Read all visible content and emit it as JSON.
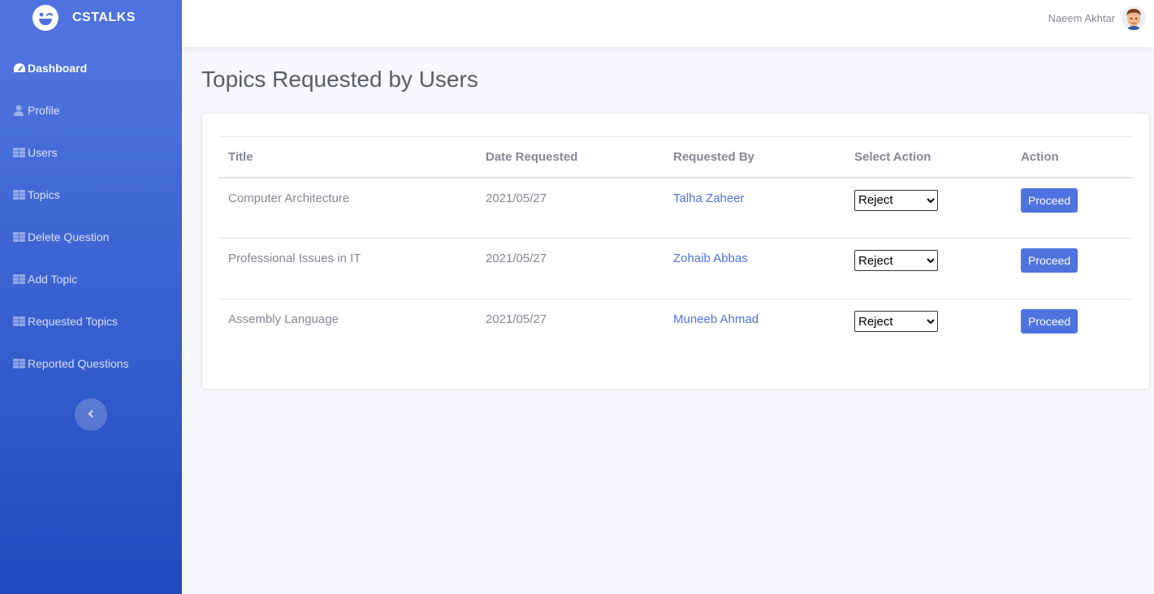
{
  "app": {
    "brand": "CSTALKS"
  },
  "sidebar": {
    "items": [
      {
        "label": "Dashboard",
        "icon": "tachometer-icon",
        "active": true
      },
      {
        "label": "Profile",
        "icon": "user-icon"
      },
      {
        "label": "Users",
        "icon": "table-icon"
      },
      {
        "label": "Topics",
        "icon": "table-icon"
      },
      {
        "label": "Delete Question",
        "icon": "table-icon"
      },
      {
        "label": "Add Topic",
        "icon": "table-icon"
      },
      {
        "label": "Requested Topics",
        "icon": "table-icon"
      },
      {
        "label": "Reported Questions",
        "icon": "table-icon"
      }
    ],
    "toggle_icon": "chevron-left-icon"
  },
  "topbar": {
    "user_name": "Naeem Akhtar"
  },
  "main": {
    "title": "Topics Requested by Users",
    "table": {
      "headers": [
        "Title",
        "Date Requested",
        "Requested By",
        "Select Action",
        "Action"
      ],
      "rows": [
        {
          "title": "Computer Architecture",
          "date": "2021/05/27",
          "requested_by": "Talha Zaheer",
          "select_value": "Reject",
          "button": "Proceed"
        },
        {
          "title": "Professional Issues in IT",
          "date": "2021/05/27",
          "requested_by": "Zohaib Abbas",
          "select_value": "Reject",
          "button": "Proceed"
        },
        {
          "title": "Assembly Language",
          "date": "2021/05/27",
          "requested_by": "Muneeb Ahmad",
          "select_value": "Reject",
          "button": "Proceed"
        }
      ]
    }
  },
  "colors": {
    "primary": "#4e73df",
    "primary_dark": "#224abe",
    "text_muted": "#858796",
    "heading": "#5a5c69"
  }
}
